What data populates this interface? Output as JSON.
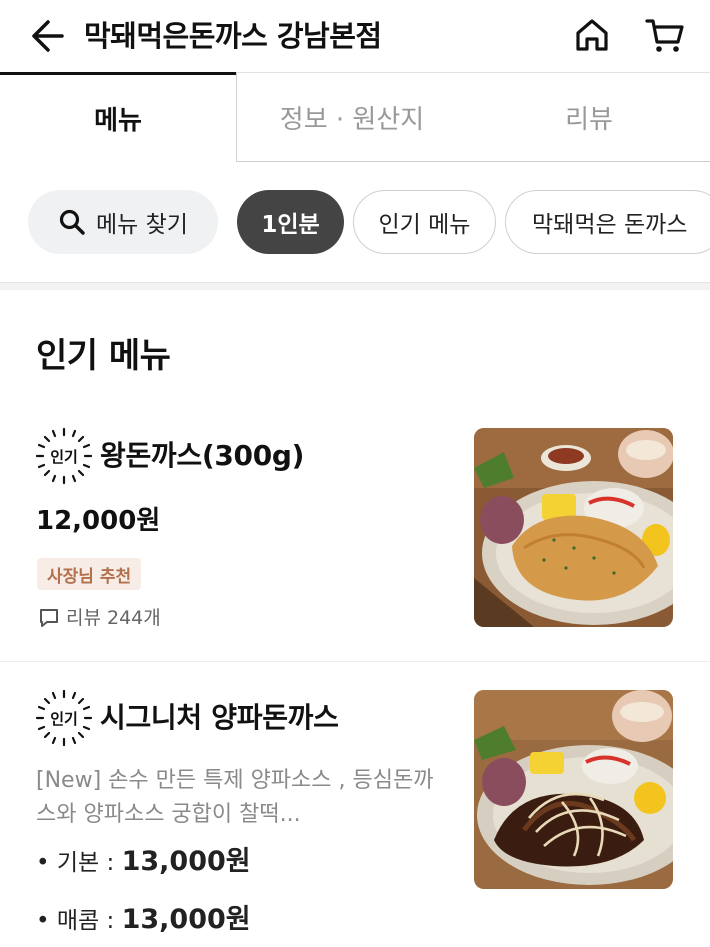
{
  "header": {
    "title": "막돼먹은돈까스 강남본점",
    "back_icon": "arrow-left-icon",
    "home_icon": "home-icon",
    "cart_icon": "cart-icon"
  },
  "tabs": [
    {
      "label": "메뉴",
      "active": true
    },
    {
      "label": "정보 · 원산지",
      "active": false
    },
    {
      "label": "리뷰",
      "active": false
    }
  ],
  "chips": {
    "search_label": "메뉴 찾기",
    "items": [
      "1인분",
      "인기 메뉴",
      "막돼먹은 돈까스"
    ]
  },
  "section": {
    "title": "인기 메뉴"
  },
  "menu_items": [
    {
      "badge": "인기",
      "name": "왕돈까스(300g)",
      "price": "12,000원",
      "tag": "사장님 추천",
      "review": "리뷰 244개"
    },
    {
      "badge": "인기",
      "name": "시그니처 양파돈까스",
      "description_line1": "[New] 손수 만든 특제 양파소스 , 등심돈까",
      "description_line2": "스와 양파소스 궁합이 찰떡...",
      "options": [
        {
          "label": "• 기본 : ",
          "price": "13,000원"
        },
        {
          "label": "• 매콤 : ",
          "price": "13,000원"
        }
      ]
    }
  ],
  "colors": {
    "active_chip_bg": "#444444",
    "tag_bg": "#f7ece6",
    "tag_text": "#b2704d"
  }
}
